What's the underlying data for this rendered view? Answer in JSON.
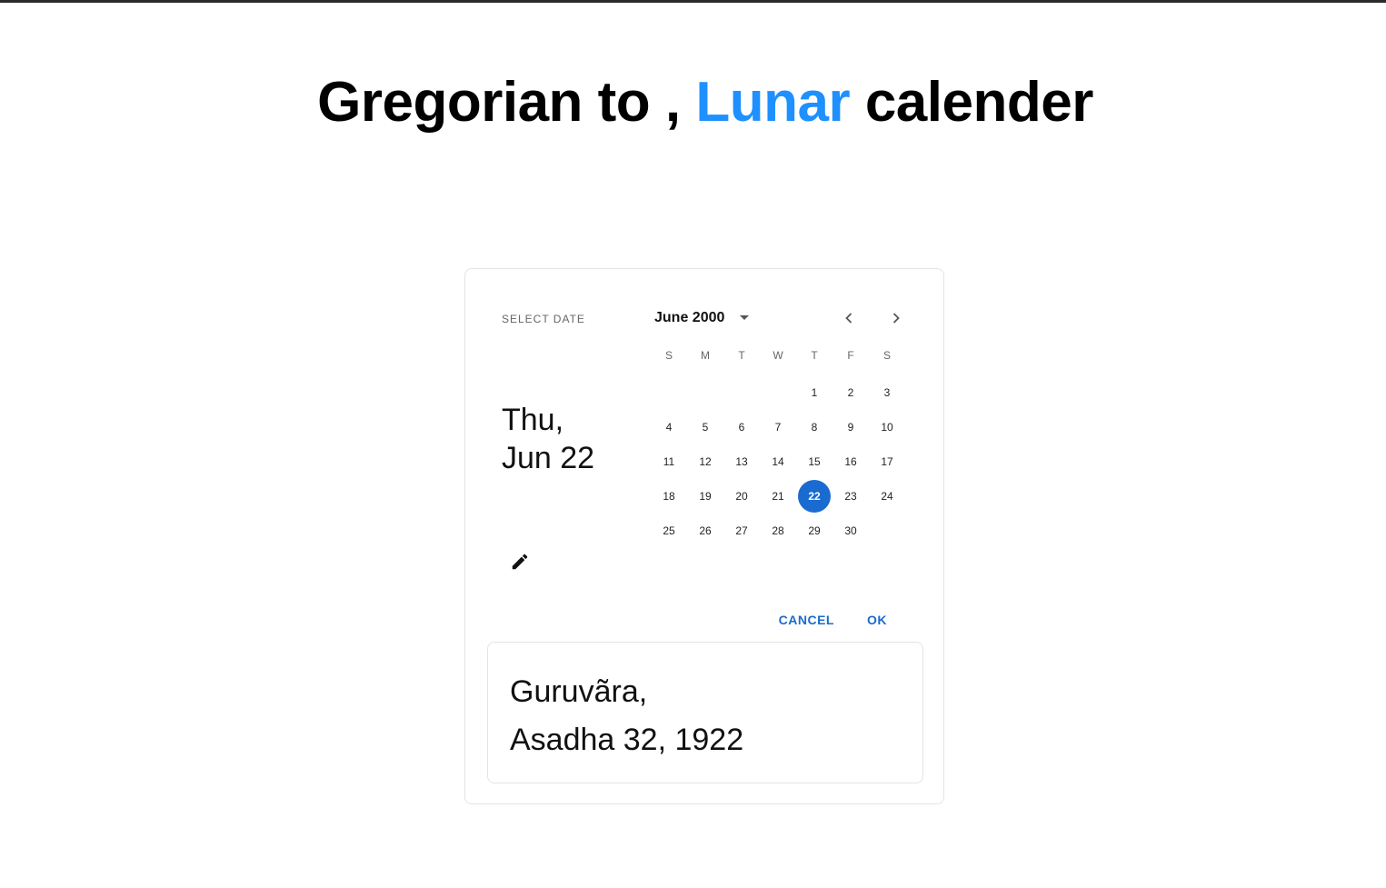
{
  "heading": {
    "part1": "Gregorian to , ",
    "accent": "Lunar",
    "part2": " calender"
  },
  "picker": {
    "toolbar_label": "SELECT DATE",
    "selected_weekday": "Thu,",
    "selected_date": "Jun 22",
    "month_label": "June 2000",
    "weekdays": [
      "S",
      "M",
      "T",
      "W",
      "T",
      "F",
      "S"
    ],
    "weeks": [
      [
        "",
        "",
        "",
        "",
        "1",
        "2",
        "3"
      ],
      [
        "4",
        "5",
        "6",
        "7",
        "8",
        "9",
        "10"
      ],
      [
        "11",
        "12",
        "13",
        "14",
        "15",
        "16",
        "17"
      ],
      [
        "18",
        "19",
        "20",
        "21",
        "22",
        "23",
        "24"
      ],
      [
        "25",
        "26",
        "27",
        "28",
        "29",
        "30",
        ""
      ]
    ],
    "selected_day": "22",
    "cancel_label": "CANCEL",
    "ok_label": "OK",
    "icons": {
      "edit": "pencil-icon",
      "dropdown": "caret-down-icon",
      "prev": "chevron-left-icon",
      "next": "chevron-right-icon"
    }
  },
  "result": {
    "line1": "Guruvãra,",
    "line2": "Asadha 32, 1922"
  },
  "colors": {
    "accent": "#1e90ff",
    "primary": "#1a6bd1"
  }
}
